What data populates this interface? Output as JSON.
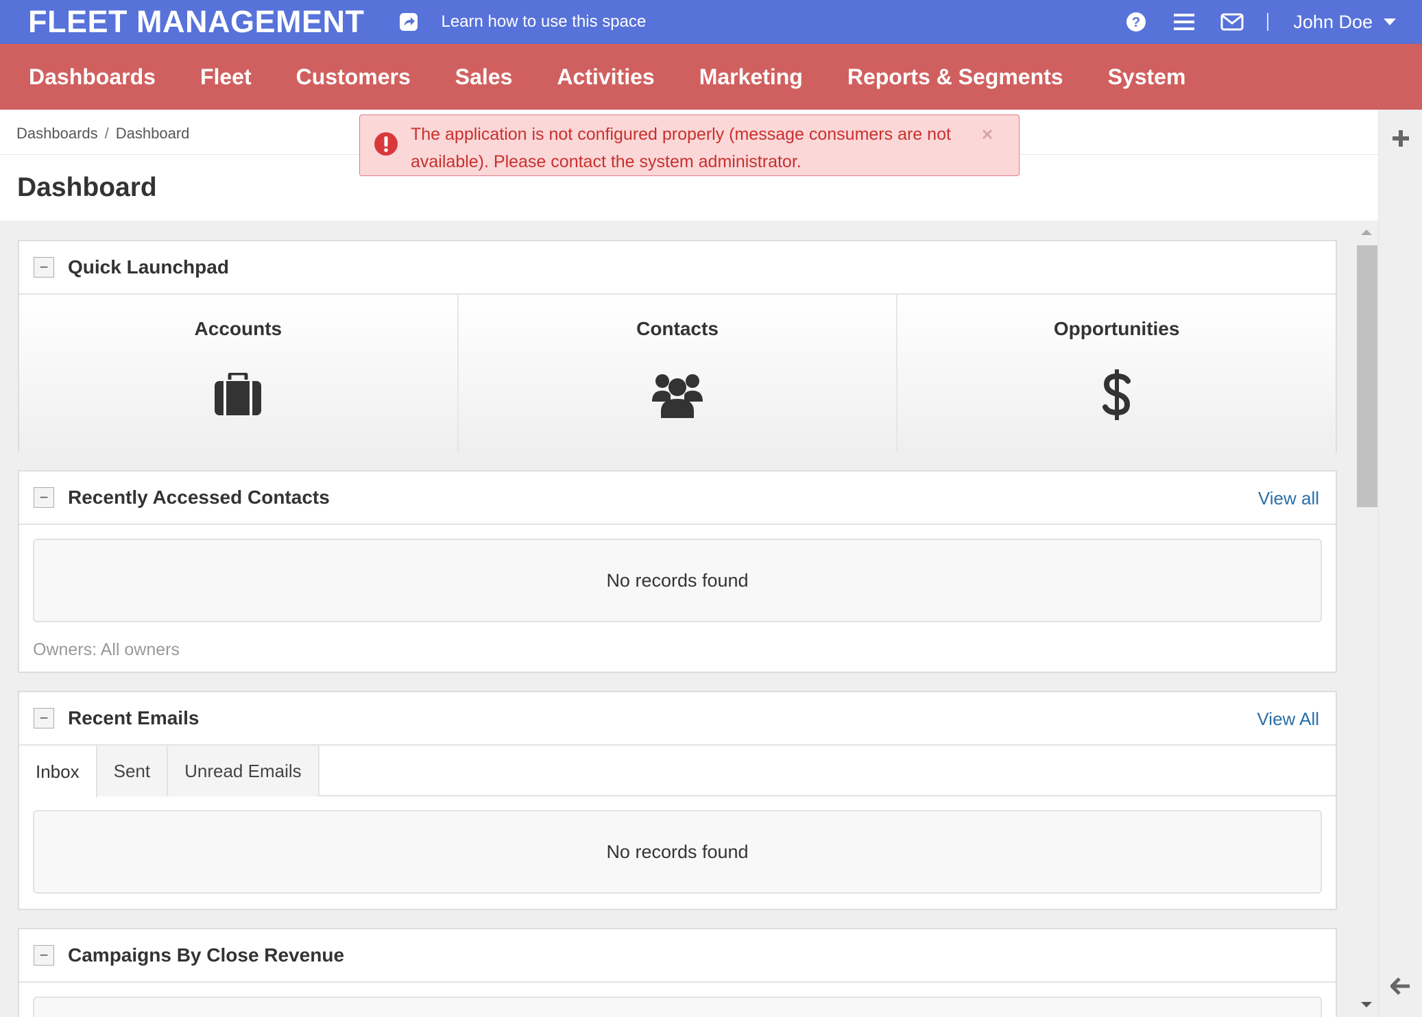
{
  "topbar": {
    "brand": "FLEET MANAGEMENT",
    "learn_link": "Learn how to use this space",
    "user_name": "John Doe"
  },
  "nav": [
    "Dashboards",
    "Fleet",
    "Customers",
    "Sales",
    "Activities",
    "Marketing",
    "Reports & Segments",
    "System"
  ],
  "breadcrumb": [
    "Dashboards",
    "Dashboard"
  ],
  "page_title": "Dashboard",
  "alert": {
    "message": "The application is not configured properly (message consumers are not available). Please contact the system administrator."
  },
  "widgets": {
    "quick_launchpad": {
      "title": "Quick Launchpad",
      "items": [
        "Accounts",
        "Contacts",
        "Opportunities"
      ]
    },
    "recent_contacts": {
      "title": "Recently Accessed Contacts",
      "view_all": "View all",
      "empty": "No records found",
      "owners": "Owners: All owners"
    },
    "recent_emails": {
      "title": "Recent Emails",
      "view_all": "View All",
      "tabs": [
        "Inbox",
        "Sent",
        "Unread Emails"
      ],
      "empty": "No records found"
    },
    "campaigns": {
      "title": "Campaigns By Close Revenue"
    }
  },
  "colors": {
    "topbar": "#5772d9",
    "navbar": "#d0605f",
    "link": "#2a6fa8",
    "alert_text": "#c9302c",
    "alert_bg": "#fbd7d8"
  }
}
